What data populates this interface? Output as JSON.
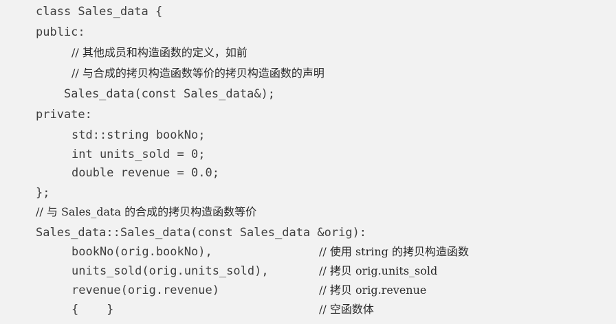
{
  "code": {
    "lines": [
      {
        "text": "class Sales_data {"
      },
      {
        "text": "public:"
      },
      {
        "text": "// 其他成员和构造函数的定义，如前"
      },
      {
        "text": "// 与合成的拷贝构造函数等价的拷贝构造函数的声明"
      },
      {
        "text": "Sales_data(const Sales_data&);"
      },
      {
        "text": "private:"
      },
      {
        "text": "std::string bookNo;"
      },
      {
        "text": "int units_sold = 0;"
      },
      {
        "text": "double revenue = 0.0;"
      },
      {
        "text": "};"
      },
      {
        "text": "// 与 Sales_data 的合成的拷贝构造函数等价"
      },
      {
        "text": "Sales_data::Sales_data(const Sales_data &orig):"
      },
      {
        "text": "bookNo(orig.bookNo),"
      },
      {
        "text": "// 使用 string 的拷贝构造函数"
      },
      {
        "text": "units_sold(orig.units_sold),"
      },
      {
        "text": "// 拷贝 orig.units_sold"
      },
      {
        "text": "revenue(orig.revenue)"
      },
      {
        "text": "// 拷贝 orig.revenue"
      },
      {
        "text": "{    }"
      },
      {
        "text": "// 空函数体"
      }
    ]
  }
}
